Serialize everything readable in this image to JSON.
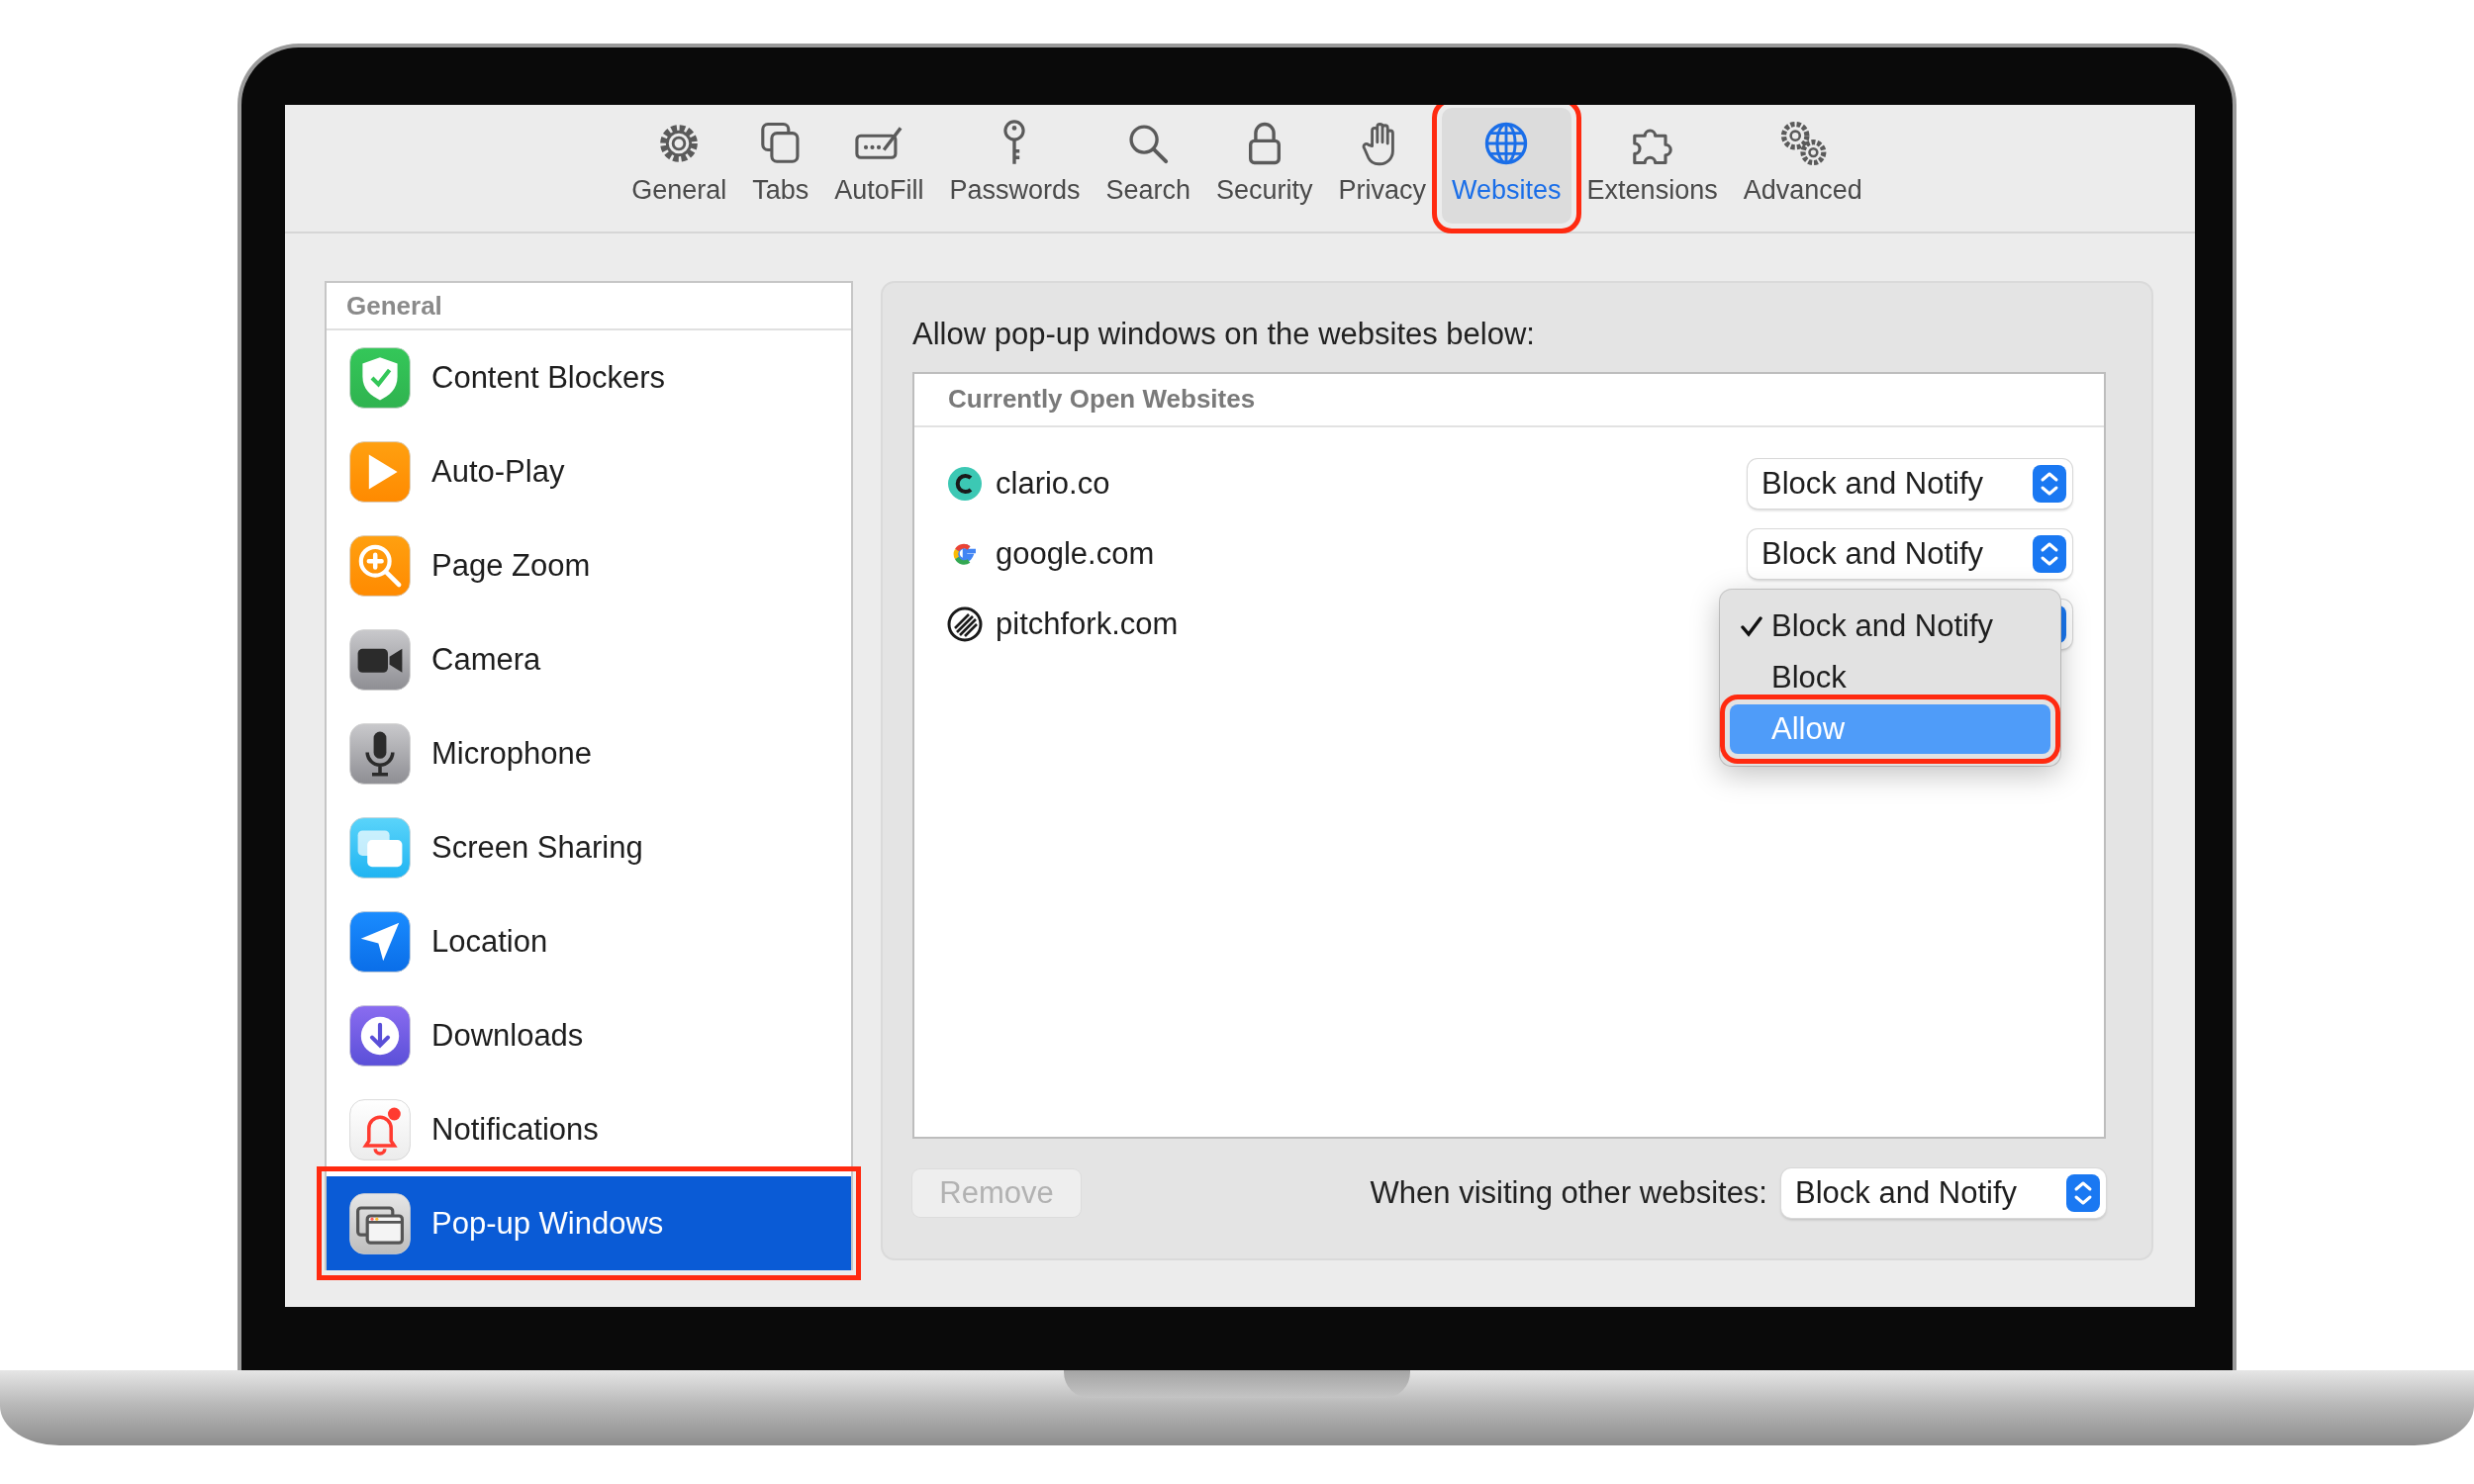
{
  "toolbar": {
    "tabs": [
      {
        "label": "General",
        "selected": false,
        "highlighted": false
      },
      {
        "label": "Tabs",
        "selected": false,
        "highlighted": false
      },
      {
        "label": "AutoFill",
        "selected": false,
        "highlighted": false
      },
      {
        "label": "Passwords",
        "selected": false,
        "highlighted": false
      },
      {
        "label": "Search",
        "selected": false,
        "highlighted": false
      },
      {
        "label": "Security",
        "selected": false,
        "highlighted": false
      },
      {
        "label": "Privacy",
        "selected": false,
        "highlighted": false
      },
      {
        "label": "Websites",
        "selected": true,
        "highlighted": true
      },
      {
        "label": "Extensions",
        "selected": false,
        "highlighted": false
      },
      {
        "label": "Advanced",
        "selected": false,
        "highlighted": false
      }
    ]
  },
  "sidebar": {
    "heading": "General",
    "items": [
      {
        "label": "Content Blockers",
        "selected": false,
        "highlighted": false
      },
      {
        "label": "Auto-Play",
        "selected": false,
        "highlighted": false
      },
      {
        "label": "Page Zoom",
        "selected": false,
        "highlighted": false
      },
      {
        "label": "Camera",
        "selected": false,
        "highlighted": false
      },
      {
        "label": "Microphone",
        "selected": false,
        "highlighted": false
      },
      {
        "label": "Screen Sharing",
        "selected": false,
        "highlighted": false
      },
      {
        "label": "Location",
        "selected": false,
        "highlighted": false
      },
      {
        "label": "Downloads",
        "selected": false,
        "highlighted": false
      },
      {
        "label": "Notifications",
        "selected": false,
        "highlighted": false
      },
      {
        "label": "Pop-up Windows",
        "selected": true,
        "highlighted": true
      }
    ]
  },
  "panel": {
    "prompt": "Allow pop-up windows on the websites below:",
    "table": {
      "heading": "Currently Open Websites",
      "rows": [
        {
          "site": "clario.co",
          "setting": "Block and Notify"
        },
        {
          "site": "google.com",
          "setting": "Block and Notify"
        },
        {
          "site": "pitchfork.com",
          "menu": [
            {
              "label": "Block and Notify",
              "checked": true,
              "selected": false,
              "highlighted": false
            },
            {
              "label": "Block",
              "checked": false,
              "selected": false,
              "highlighted": false
            },
            {
              "label": "Allow",
              "checked": false,
              "selected": true,
              "highlighted": true
            }
          ]
        }
      ]
    },
    "remove_button": {
      "label": "Remove",
      "disabled": true
    },
    "default_label": "When visiting other websites:",
    "default_setting": "Block and Notify"
  }
}
